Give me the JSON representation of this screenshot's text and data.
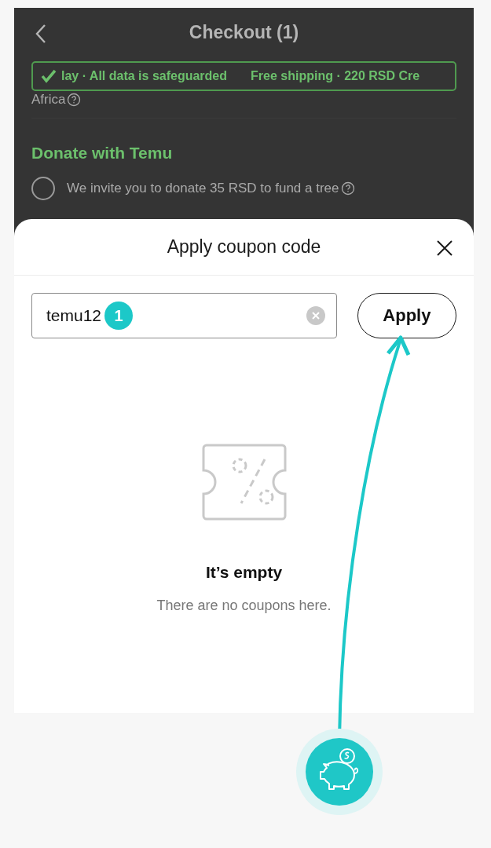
{
  "header": {
    "title": "Checkout (1)"
  },
  "trust_banner": {
    "left": "lay · All data is safeguarded",
    "right": "Free shipping · 220 RSD Cre"
  },
  "address_fragment": "Africa",
  "donate": {
    "title": "Donate with Temu",
    "option": "We invite you to donate 35 RSD to fund a tree",
    "checked": false
  },
  "sheet": {
    "title": "Apply coupon code",
    "field": {
      "value": "temu12"
    },
    "step_badge": "1",
    "apply_button": "Apply",
    "empty": {
      "title": "It’s empty",
      "message": "There are no coupons here."
    }
  }
}
